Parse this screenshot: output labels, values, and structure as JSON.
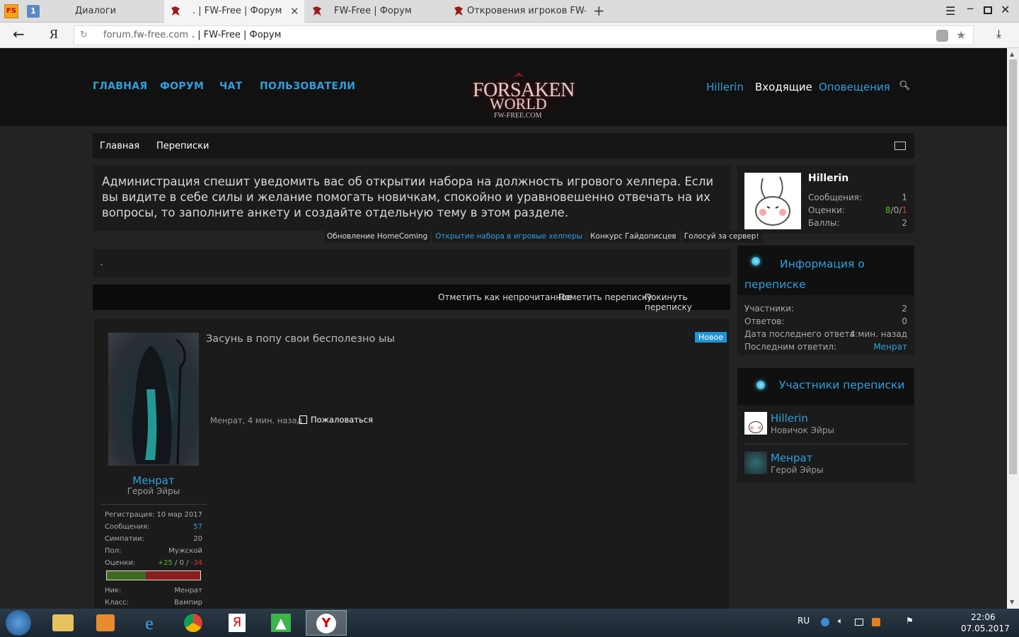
{
  "browser": {
    "tabs": [
      {
        "label": "Диалоги"
      },
      {
        "label": ". | FW-Free | Форум"
      },
      {
        "label": "FW-Free | Форум"
      },
      {
        "label": "Откровения игроков FW-FF"
      }
    ],
    "url_host": "forum.fw-free.com",
    "url_title": ". | FW-Free | Форум",
    "pinned_fs": "FS",
    "pinned_num": "1"
  },
  "header": {
    "nav": [
      "ГЛАВНАЯ",
      "ФОРУМ",
      "ЧАТ",
      "ПОЛЬЗОВАТЕЛИ"
    ],
    "user": "Hillerin",
    "inbox": "Входящие",
    "alerts": "Оповещения",
    "logo_line1": "FORSAKEN",
    "logo_line2": "WORLD",
    "logo_line3": "FW-FREE.COM"
  },
  "breadcrumb": {
    "home": "Главная",
    "section": "Переписки"
  },
  "notice": {
    "text": "Администрация спешит уведомить вас об открытии набора на должность игрового хелпера. Если вы видите в себе силы и желание помогать новичкам, спокойно и уравновешенно отвечать на их вопросы, то заполните анкету и создайте отдельную тему в этом разделе.",
    "tabs": [
      "Обновление HomeComing",
      "Открытие набора в игровые хелперы",
      "Конкурс Гайдописцев",
      "Голосуй за сервер!"
    ],
    "active_tab": 1
  },
  "conversation": {
    "title": ".",
    "actions": [
      "Отметить как непрочитанное",
      "Пометить переписку",
      "Покинуть переписку"
    ]
  },
  "post": {
    "author": "Менрат",
    "author_title": "Герой Эйры",
    "message": "Засунь в попу свои бесполезно ыы",
    "badge": "Новое",
    "meta": "Менрат, 4 мин. назад",
    "report": "Пожаловаться",
    "stats": [
      {
        "label": "Регистрация:",
        "value": "10 мар 2017"
      },
      {
        "label": "Сообщения:",
        "value": "57"
      },
      {
        "label": "Симпатии:",
        "value": "20"
      },
      {
        "label": "Пол:",
        "value": "Мужской"
      }
    ],
    "ratings_label": "Оценки:",
    "ratings_pos": "+25",
    "ratings_mid": " / 0 / ",
    "ratings_neg": "-34",
    "rating_pos_fraction": 0.42,
    "extra": [
      {
        "label": "Ник:",
        "value": "Менрат"
      },
      {
        "label": "Класс:",
        "value": "Вампир"
      }
    ]
  },
  "sidebar": {
    "user": {
      "name": "Hillerin",
      "messages_label": "Сообщения:",
      "messages": "1",
      "ratings_label": "Оценки:",
      "r_pos": "8",
      "r_mid": "0",
      "r_neg": "1",
      "points_label": "Баллы:",
      "points": "2"
    },
    "info": {
      "title": "Информация о переписке",
      "rows": [
        {
          "label": "Участники:",
          "value": "2"
        },
        {
          "label": "Ответов:",
          "value": "0"
        },
        {
          "label": "Дата последнего ответа:",
          "value": "4 мин. назад"
        },
        {
          "label": "Последним ответил:",
          "value": "Менрат"
        }
      ]
    },
    "participants": {
      "title": "Участники переписки",
      "list": [
        {
          "name": "Hillerin",
          "title": "Новичок Эйры"
        },
        {
          "name": "Менрат",
          "title": "Герой Эйры"
        }
      ]
    }
  },
  "taskbar": {
    "lang": "RU",
    "time": "22:06",
    "date": "07.05.2017"
  },
  "colors": {
    "accent": "#2ea0dd",
    "header_bg": "#111111",
    "page_bg": "#232323",
    "block_bg": "#1b1b1b",
    "new_badge": "#1e95d4",
    "positive": "#5ab82c",
    "negative": "#d13a2f"
  }
}
